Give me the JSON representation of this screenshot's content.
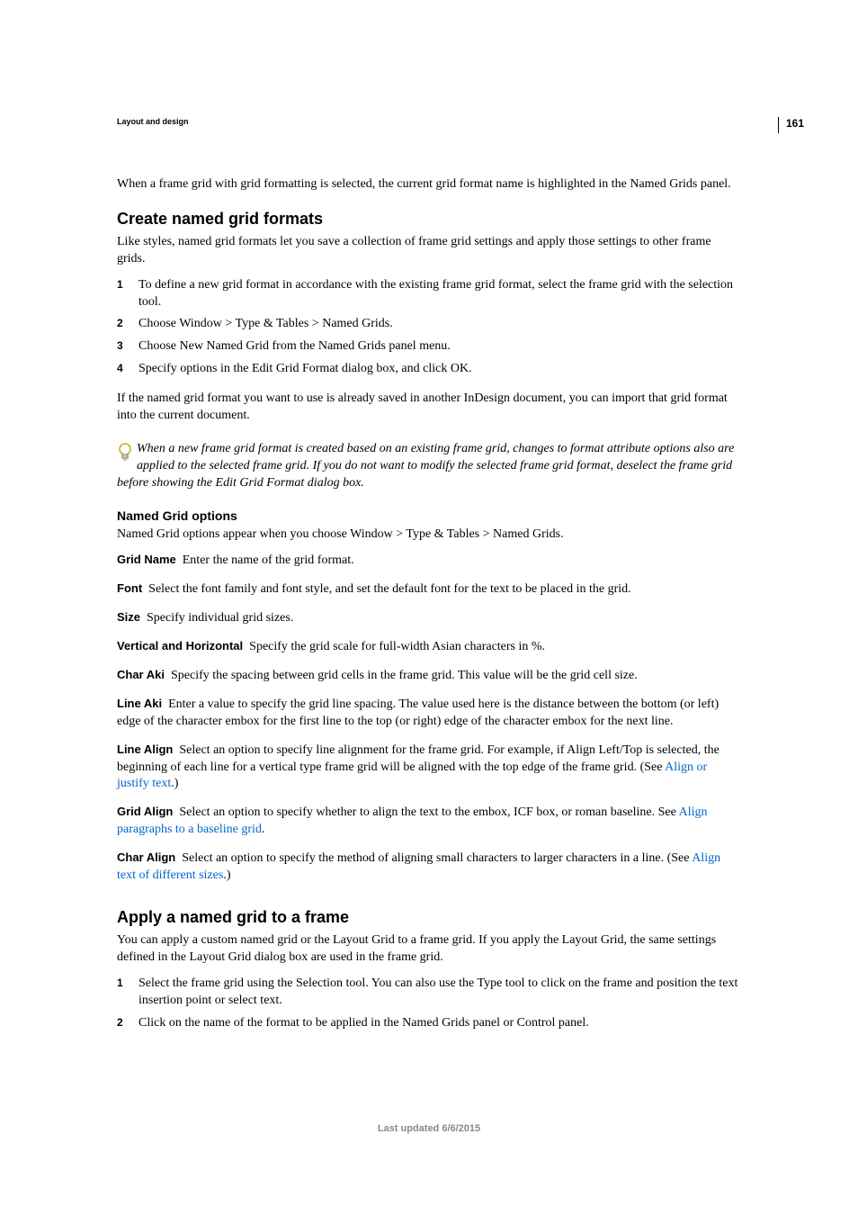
{
  "page_number": "161",
  "section_header": "Layout and design",
  "intro_para": "When a frame grid with grid formatting is selected, the current grid format name is highlighted in the Named Grids panel.",
  "h2_create": "Create named grid formats",
  "create_intro": "Like styles, named grid formats let you save a collection of frame grid settings and apply those settings to other frame grids.",
  "steps_create": [
    {
      "num": "1",
      "text": "To define a new grid format in accordance with the existing frame grid format, select the frame grid with the selection tool."
    },
    {
      "num": "2",
      "text": "Choose Window > Type & Tables > Named Grids."
    },
    {
      "num": "3",
      "text": "Choose New Named Grid from the Named Grids panel menu."
    },
    {
      "num": "4",
      "text": "Specify options in the Edit Grid Format dialog box, and click OK."
    }
  ],
  "create_post": "If the named grid format you want to use is already saved in another InDesign document, you can import that grid format into the current document.",
  "tip_text": "When a new frame grid format is created based on an existing frame grid, changes to format attribute options also are applied to the selected frame grid. If you do not want to modify the selected frame grid format, deselect the frame grid before showing the Edit Grid Format dialog box.",
  "h3_options": "Named Grid options",
  "options_intro": "Named Grid options appear when you choose Window > Type & Tables > Named Grids.",
  "defs": {
    "grid_name": {
      "term": "Grid Name",
      "text": "Enter the name of the grid format."
    },
    "font": {
      "term": "Font",
      "text": "Select the font family and font style, and set the default font for the text to be placed in the grid."
    },
    "size": {
      "term": "Size",
      "text": "Specify individual grid sizes."
    },
    "vh": {
      "term": "Vertical and Horizontal",
      "text": "Specify the grid scale for full-width Asian characters in %."
    },
    "char_aki": {
      "term": "Char Aki",
      "text": "Specify the spacing between grid cells in the frame grid. This value will be the grid cell size."
    },
    "line_aki": {
      "term": "Line Aki",
      "text": "Enter a value to specify the grid line spacing. The value used here is the distance between the bottom (or left) edge of the character embox for the first line to the top (or right) edge of the character embox for the next line."
    },
    "line_align": {
      "term": "Line Align",
      "text_before": "Select an option to specify line alignment for the frame grid. For example, if Align Left/Top is selected, the beginning of each line for a vertical type frame grid will be aligned with the top edge of the frame grid. (See ",
      "link": "Align or justify text",
      "text_after": ".)"
    },
    "grid_align": {
      "term": "Grid Align",
      "text_before": "Select an option to specify whether to align the text to the embox, ICF box, or roman baseline. See ",
      "link": "Align paragraphs to a baseline grid",
      "text_after": "."
    },
    "char_align": {
      "term": "Char Align",
      "text_before": "Select an option to specify the method of aligning small characters to larger characters in a line. (See ",
      "link": "Align text of different sizes",
      "text_after": ".)"
    }
  },
  "h2_apply": "Apply a named grid to a frame",
  "apply_intro": "You can apply a custom named grid or the Layout Grid to a frame grid. If you apply the Layout Grid, the same settings defined in the Layout Grid dialog box are used in the frame grid.",
  "steps_apply": [
    {
      "num": "1",
      "text": "Select the frame grid using the Selection tool. You can also use the Type tool to click on the frame and position the text insertion point or select text."
    },
    {
      "num": "2",
      "text": "Click on the name of the format to be applied in the Named Grids panel or Control panel."
    }
  ],
  "footer": "Last updated 6/6/2015"
}
